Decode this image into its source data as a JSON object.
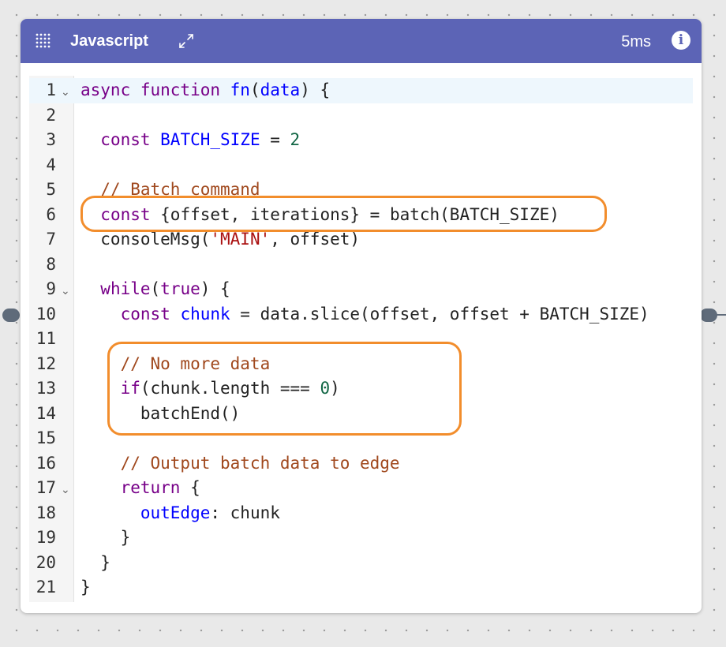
{
  "node": {
    "title": "Javascript",
    "timing": "5ms",
    "info_glyph": "i",
    "icons": {
      "drag": "drag-handle-icon",
      "expand": "expand-icon",
      "info": "info-icon"
    }
  },
  "colors": {
    "header": "#5c64b6",
    "highlight": "#f28d2c",
    "keyword": "#770088",
    "variable": "#0000ff",
    "number": "#116644",
    "string": "#aa1111",
    "comment": "#a0481d"
  },
  "editor": {
    "active_line": 1,
    "lines": [
      {
        "num": "1",
        "fold": "⌄",
        "tokens": [
          {
            "t": "async function ",
            "c": "k"
          },
          {
            "t": "fn",
            "c": "v"
          },
          {
            "t": "("
          },
          {
            "t": "data",
            "c": "v"
          },
          {
            "t": ") {"
          }
        ]
      },
      {
        "num": "2",
        "tokens": []
      },
      {
        "num": "3",
        "tokens": [
          {
            "t": "  "
          },
          {
            "t": "const ",
            "c": "k"
          },
          {
            "t": "BATCH_SIZE",
            "c": "v"
          },
          {
            "t": " = "
          },
          {
            "t": "2",
            "c": "n"
          }
        ]
      },
      {
        "num": "4",
        "tokens": []
      },
      {
        "num": "5",
        "tokens": [
          {
            "t": "  // Batch command",
            "c": "c"
          }
        ]
      },
      {
        "num": "6",
        "tokens": [
          {
            "t": "  "
          },
          {
            "t": "const ",
            "c": "k"
          },
          {
            "t": "{offset, iterations} = batch(BATCH_SIZE)"
          }
        ]
      },
      {
        "num": "7",
        "tokens": [
          {
            "t": "  consoleMsg("
          },
          {
            "t": "'MAIN'",
            "c": "s"
          },
          {
            "t": ", offset)"
          }
        ]
      },
      {
        "num": "8",
        "tokens": []
      },
      {
        "num": "9",
        "fold": "⌄",
        "tokens": [
          {
            "t": "  "
          },
          {
            "t": "while",
            "c": "k"
          },
          {
            "t": "("
          },
          {
            "t": "true",
            "c": "k"
          },
          {
            "t": ") {"
          }
        ]
      },
      {
        "num": "10",
        "tokens": [
          {
            "t": "    "
          },
          {
            "t": "const ",
            "c": "k"
          },
          {
            "t": "chunk",
            "c": "v"
          },
          {
            "t": " = data.slice(offset, offset + BATCH_SIZE)"
          }
        ]
      },
      {
        "num": "11",
        "tokens": []
      },
      {
        "num": "12",
        "tokens": [
          {
            "t": "    // No more data",
            "c": "c"
          }
        ]
      },
      {
        "num": "13",
        "tokens": [
          {
            "t": "    "
          },
          {
            "t": "if",
            "c": "k"
          },
          {
            "t": "(chunk.length === "
          },
          {
            "t": "0",
            "c": "n"
          },
          {
            "t": ")"
          }
        ]
      },
      {
        "num": "14",
        "tokens": [
          {
            "t": "      batchEnd()"
          }
        ]
      },
      {
        "num": "15",
        "tokens": []
      },
      {
        "num": "16",
        "tokens": [
          {
            "t": "    // Output batch data to edge",
            "c": "c"
          }
        ]
      },
      {
        "num": "17",
        "fold": "⌄",
        "tokens": [
          {
            "t": "    "
          },
          {
            "t": "return",
            "c": "k"
          },
          {
            "t": " {"
          }
        ]
      },
      {
        "num": "18",
        "tokens": [
          {
            "t": "      "
          },
          {
            "t": "outEdge",
            "c": "v"
          },
          {
            "t": ": chunk"
          }
        ]
      },
      {
        "num": "19",
        "tokens": [
          {
            "t": "    }"
          }
        ]
      },
      {
        "num": "20",
        "tokens": [
          {
            "t": "  }"
          }
        ]
      },
      {
        "num": "21",
        "tokens": [
          {
            "t": "}"
          }
        ]
      }
    ]
  }
}
